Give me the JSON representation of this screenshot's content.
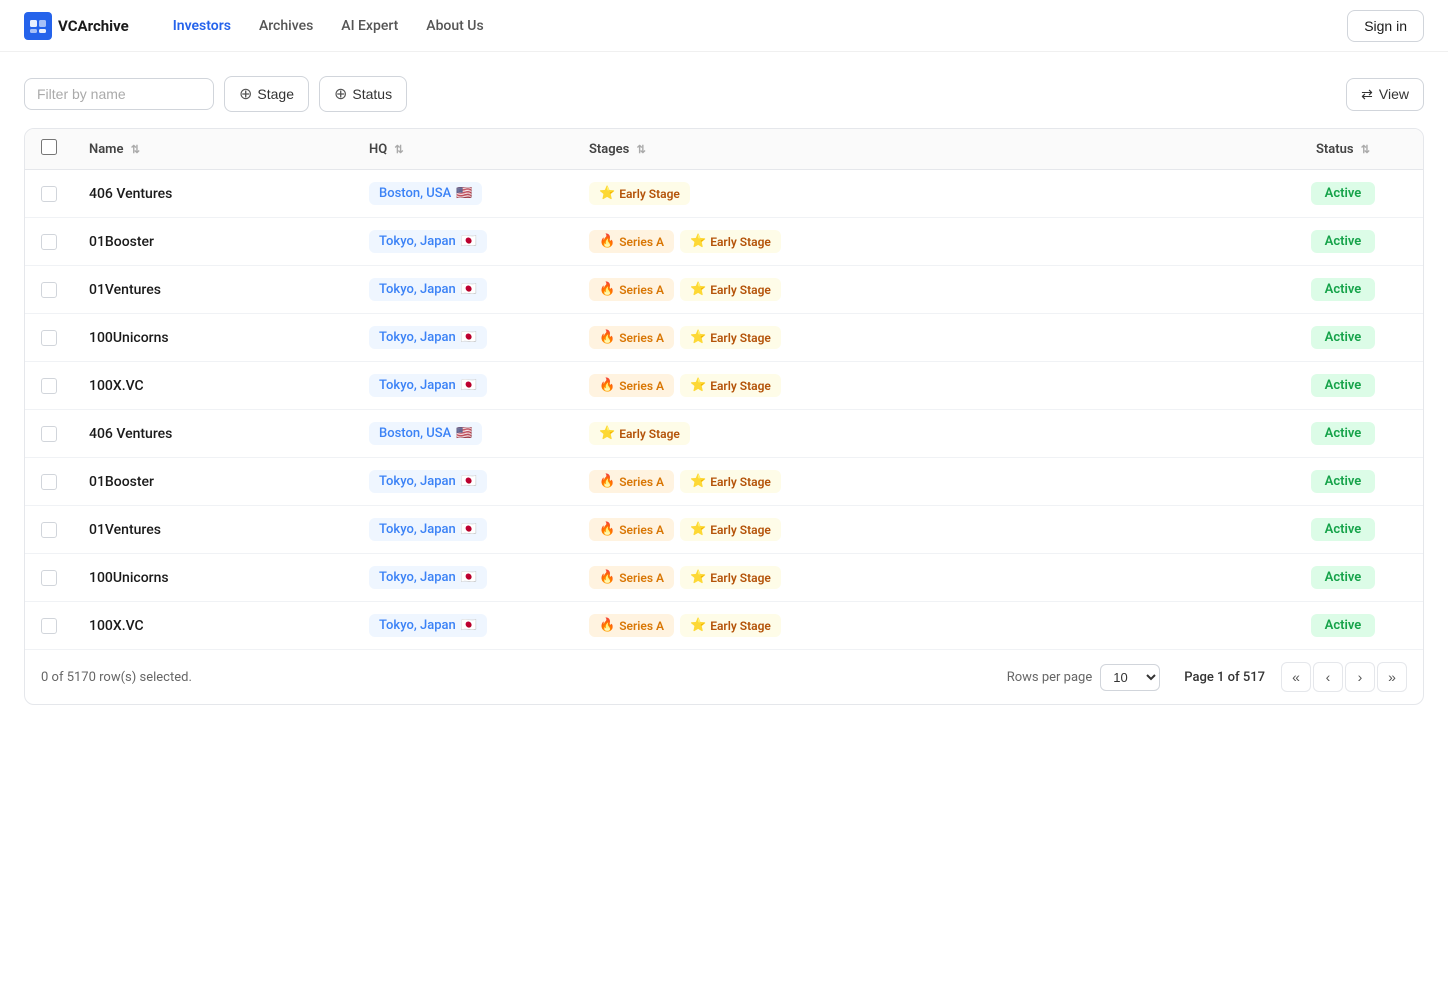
{
  "nav": {
    "logo_text": "VCArchive",
    "links": [
      {
        "label": "Investors",
        "active": true
      },
      {
        "label": "Archives",
        "active": false
      },
      {
        "label": "AI Expert",
        "active": false
      },
      {
        "label": "About Us",
        "active": false
      }
    ],
    "sign_in": "Sign in"
  },
  "toolbar": {
    "filter_placeholder": "Filter by name",
    "stage_label": "Stage",
    "status_label": "Status",
    "view_label": "View"
  },
  "table": {
    "columns": {
      "name": "Name",
      "hq": "HQ",
      "stages": "Stages",
      "status": "Status"
    },
    "rows": [
      {
        "name": "406 Ventures",
        "hq": "Boston, USA",
        "hq_flag": "🇺🇸",
        "stages": [
          {
            "type": "early",
            "icon": "⭐",
            "label": "Early Stage"
          }
        ],
        "status": "Active"
      },
      {
        "name": "01Booster",
        "hq": "Tokyo, Japan",
        "hq_flag": "🇯🇵",
        "stages": [
          {
            "type": "series-a",
            "icon": "🔥",
            "label": "Series A"
          },
          {
            "type": "early",
            "icon": "⭐",
            "label": "Early Stage"
          }
        ],
        "status": "Active"
      },
      {
        "name": "01Ventures",
        "hq": "Tokyo, Japan",
        "hq_flag": "🇯🇵",
        "stages": [
          {
            "type": "series-a",
            "icon": "🔥",
            "label": "Series A"
          },
          {
            "type": "early",
            "icon": "⭐",
            "label": "Early Stage"
          }
        ],
        "status": "Active"
      },
      {
        "name": "100Unicorns",
        "hq": "Tokyo, Japan",
        "hq_flag": "🇯🇵",
        "stages": [
          {
            "type": "series-a",
            "icon": "🔥",
            "label": "Series A"
          },
          {
            "type": "early",
            "icon": "⭐",
            "label": "Early Stage"
          }
        ],
        "status": "Active"
      },
      {
        "name": "100X.VC",
        "hq": "Tokyo, Japan",
        "hq_flag": "🇯🇵",
        "stages": [
          {
            "type": "series-a",
            "icon": "🔥",
            "label": "Series A"
          },
          {
            "type": "early",
            "icon": "⭐",
            "label": "Early Stage"
          }
        ],
        "status": "Active"
      },
      {
        "name": "406 Ventures",
        "hq": "Boston, USA",
        "hq_flag": "🇺🇸",
        "stages": [
          {
            "type": "early",
            "icon": "⭐",
            "label": "Early Stage"
          }
        ],
        "status": "Active"
      },
      {
        "name": "01Booster",
        "hq": "Tokyo, Japan",
        "hq_flag": "🇯🇵",
        "stages": [
          {
            "type": "series-a",
            "icon": "🔥",
            "label": "Series A"
          },
          {
            "type": "early",
            "icon": "⭐",
            "label": "Early Stage"
          }
        ],
        "status": "Active"
      },
      {
        "name": "01Ventures",
        "hq": "Tokyo, Japan",
        "hq_flag": "🇯🇵",
        "stages": [
          {
            "type": "series-a",
            "icon": "🔥",
            "label": "Series A"
          },
          {
            "type": "early",
            "icon": "⭐",
            "label": "Early Stage"
          }
        ],
        "status": "Active"
      },
      {
        "name": "100Unicorns",
        "hq": "Tokyo, Japan",
        "hq_flag": "🇯🇵",
        "stages": [
          {
            "type": "series-a",
            "icon": "🔥",
            "label": "Series A"
          },
          {
            "type": "early",
            "icon": "⭐",
            "label": "Early Stage"
          }
        ],
        "status": "Active"
      },
      {
        "name": "100X.VC",
        "hq": "Tokyo, Japan",
        "hq_flag": "🇯🇵",
        "stages": [
          {
            "type": "series-a",
            "icon": "🔥",
            "label": "Series A"
          },
          {
            "type": "early",
            "icon": "⭐",
            "label": "Early Stage"
          }
        ],
        "status": "Active"
      }
    ]
  },
  "footer": {
    "selected_text": "0 of 5170 row(s) selected.",
    "rows_per_page_label": "Rows per page",
    "rows_per_page_value": "10",
    "page_info": "Page 1 of 517",
    "pagination": {
      "first": "«",
      "prev": "‹",
      "next": "›",
      "last": "»"
    }
  }
}
